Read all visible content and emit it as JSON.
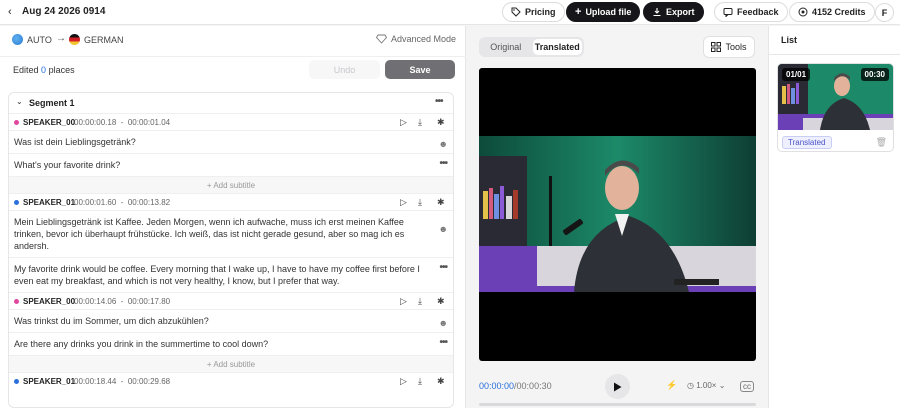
{
  "header": {
    "title": "Aug 24 2026 0914",
    "pricing_label": "Pricing",
    "upload_label": "Upload file",
    "export_label": "Export",
    "feedback_label": "Feedback",
    "credits_label": "4152 Credits",
    "avatar_initial": "F"
  },
  "languages": {
    "source": "AUTO",
    "target": "GERMAN",
    "advanced_label": "Advanced Mode"
  },
  "edit_bar": {
    "prefix": "Edited",
    "count": "0",
    "suffix": "places",
    "undo_label": "Undo",
    "save_label": "Save"
  },
  "segment": {
    "title": "Segment 1",
    "add_subtitle_label": "+ Add subtitle",
    "entries": [
      {
        "speaker": "SPEAKER_00",
        "start": "00:00:00.18",
        "end": "00:00:01.04",
        "color": "#e0479e",
        "original": "Was ist dein Lieblingsgetränk?",
        "translation": "What's your favorite drink?"
      },
      {
        "speaker": "SPEAKER_01",
        "start": "00:00:01.60",
        "end": "00:00:13.82",
        "color": "#2a6fdb",
        "original": "Mein Lieblingsgetränk ist Kaffee. Jeden Morgen, wenn ich aufwache, muss ich erst meinen Kaffee trinken, bevor ich überhaupt frühstücke. Ich weiß, das ist nicht gerade gesund, aber so mag ich es andersh.",
        "translation": "My favorite drink would be coffee. Every morning that I wake up, I have to have my coffee first before I even eat my breakfast, and which is not very healthy, I know, but I prefer that way."
      },
      {
        "speaker": "SPEAKER_00",
        "start": "00:00:14.06",
        "end": "00:00:17.80",
        "color": "#e0479e",
        "original": "Was trinkst du im Sommer, um dich abzukühlen?",
        "translation": "Are there any drinks you drink in the summertime to cool down?"
      },
      {
        "speaker": "SPEAKER_01",
        "start": "00:00:18.44",
        "end": "00:00:29.68",
        "color": "#2a6fdb"
      }
    ]
  },
  "preview": {
    "original_tab": "Original",
    "translated_tab": "Translated",
    "tools_label": "Tools",
    "current_time": "00:00:00",
    "total_time": "/00:00:30",
    "speed_label": "1.00×",
    "progress": 0
  },
  "list_panel": {
    "heading": "List",
    "card": {
      "index": "01/01",
      "duration": "00:30",
      "status": "Translated"
    }
  }
}
